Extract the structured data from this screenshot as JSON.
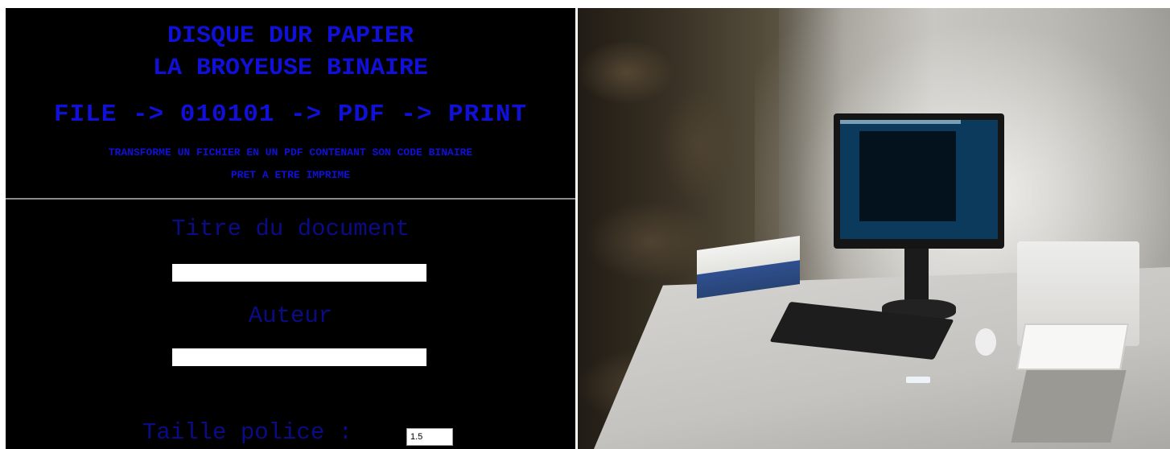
{
  "header": {
    "title_line1": "DISQUE DUR PAPIER",
    "title_line2": "LA BROYEUSE BINAIRE",
    "flow": "FILE -> 010101 -> PDF -> PRINT",
    "description_line1": "TRANSFORME UN FICHIER EN UN PDF CONTENANT SON CODE BINAIRE",
    "description_line2": "PRET A ETRE IMPRIME"
  },
  "form": {
    "title_label": "Titre du document",
    "title_value": "",
    "author_label": "Auteur",
    "author_value": "",
    "font_size_label": "Taille police :",
    "font_size_value": "1.5"
  },
  "colors": {
    "background": "#000000",
    "heading_blue": "#1010d8",
    "label_blue": "#0b0b88",
    "input_bg": "#ffffff"
  }
}
